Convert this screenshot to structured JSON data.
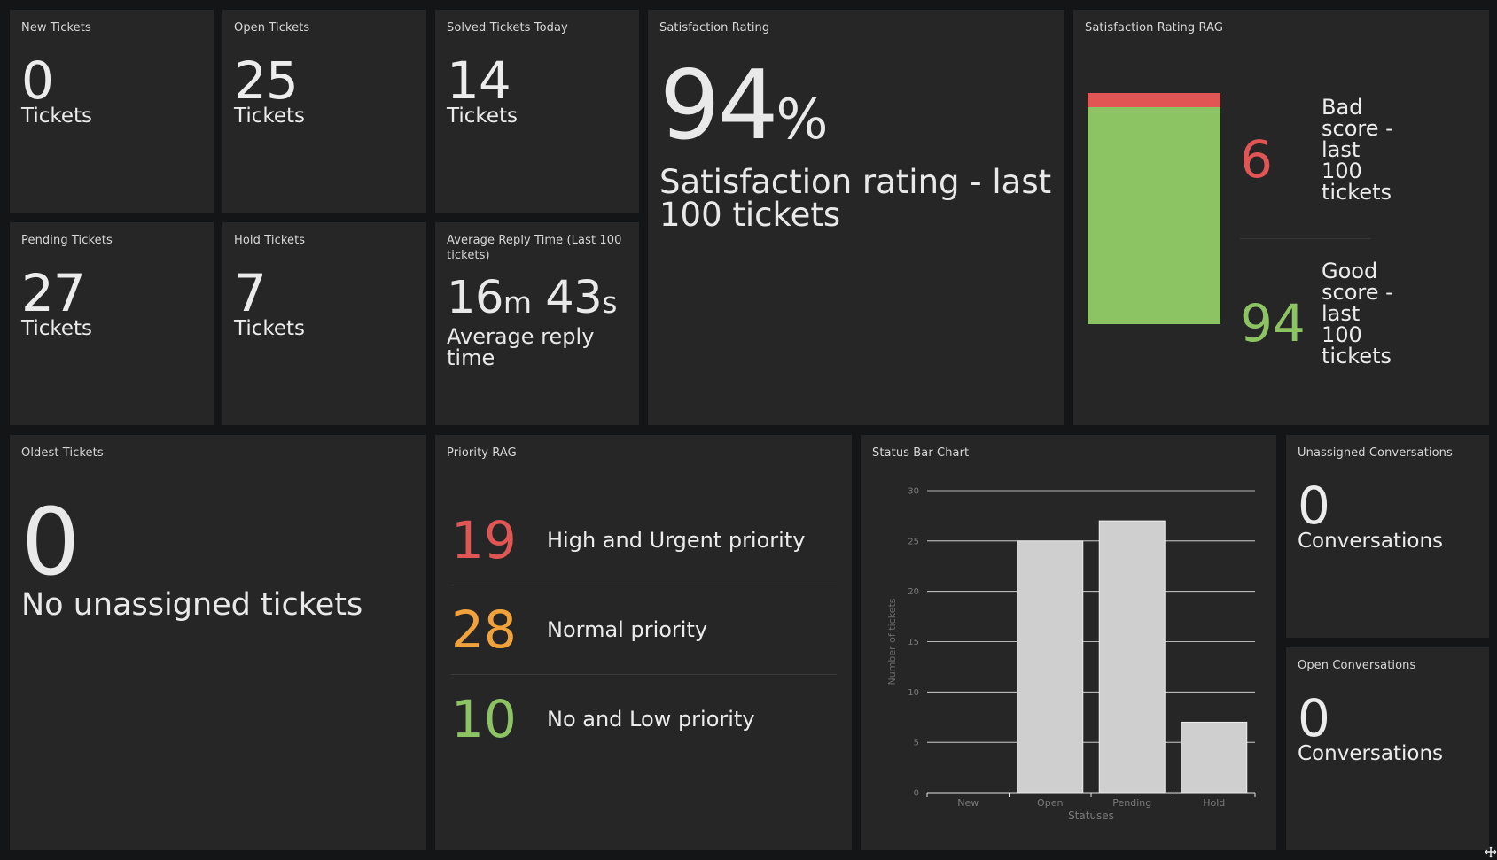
{
  "colors": {
    "red": "#e15554",
    "orange": "#f2a23a",
    "green": "#8dc463",
    "tile_bg": "#262627",
    "page_bg": "#141516"
  },
  "tiles": {
    "new_tickets": {
      "title": "New Tickets",
      "value": "0",
      "unit": "Tickets"
    },
    "open_tickets": {
      "title": "Open Tickets",
      "value": "25",
      "unit": "Tickets"
    },
    "solved_today": {
      "title": "Solved Tickets Today",
      "value": "14",
      "unit": "Tickets"
    },
    "pending": {
      "title": "Pending Tickets",
      "value": "27",
      "unit": "Tickets"
    },
    "hold": {
      "title": "Hold Tickets",
      "value": "7",
      "unit": "Tickets"
    },
    "reply_time": {
      "title": "Average Reply Time (Last 100 tickets)",
      "minutes": "16",
      "minutes_unit": "m",
      "seconds": "43",
      "seconds_unit": "s",
      "desc": "Average reply time"
    },
    "satisfaction": {
      "title": "Satisfaction Rating",
      "value": "94",
      "unit": "%",
      "desc": "Satisfaction rating - last 100 tickets"
    },
    "satisfaction_rag": {
      "title": "Satisfaction Rating RAG",
      "bad_value": "6",
      "bad_label": "Bad score - last 100 tickets",
      "good_value": "94",
      "good_label": "Good score - last 100 tickets",
      "bad_fraction": 0.06
    },
    "oldest": {
      "title": "Oldest Tickets",
      "value": "0",
      "desc": "No unassigned tickets"
    },
    "priority": {
      "title": "Priority RAG",
      "rows": [
        {
          "value": "19",
          "label": "High and Urgent priority",
          "color": "#e15554"
        },
        {
          "value": "28",
          "label": "Normal priority",
          "color": "#f2a23a"
        },
        {
          "value": "10",
          "label": "No and Low priority",
          "color": "#8dc463"
        }
      ]
    },
    "status_chart": {
      "title": "Status Bar Chart"
    },
    "unassigned_conv": {
      "title": "Unassigned Conversations",
      "value": "0",
      "unit": "Conversations"
    },
    "open_conv": {
      "title": "Open Conversations",
      "value": "0",
      "unit": "Conversations"
    }
  },
  "chart_data": {
    "type": "bar",
    "categories": [
      "New",
      "Open",
      "Pending",
      "Hold"
    ],
    "values": [
      0,
      25,
      27,
      7
    ],
    "xlabel": "Statuses",
    "ylabel": "Number of tickets",
    "ylim": [
      0,
      30
    ],
    "yticks": [
      0,
      5,
      10,
      15,
      20,
      25,
      30
    ],
    "grid": true,
    "bar_color": "#cfcfcf"
  }
}
